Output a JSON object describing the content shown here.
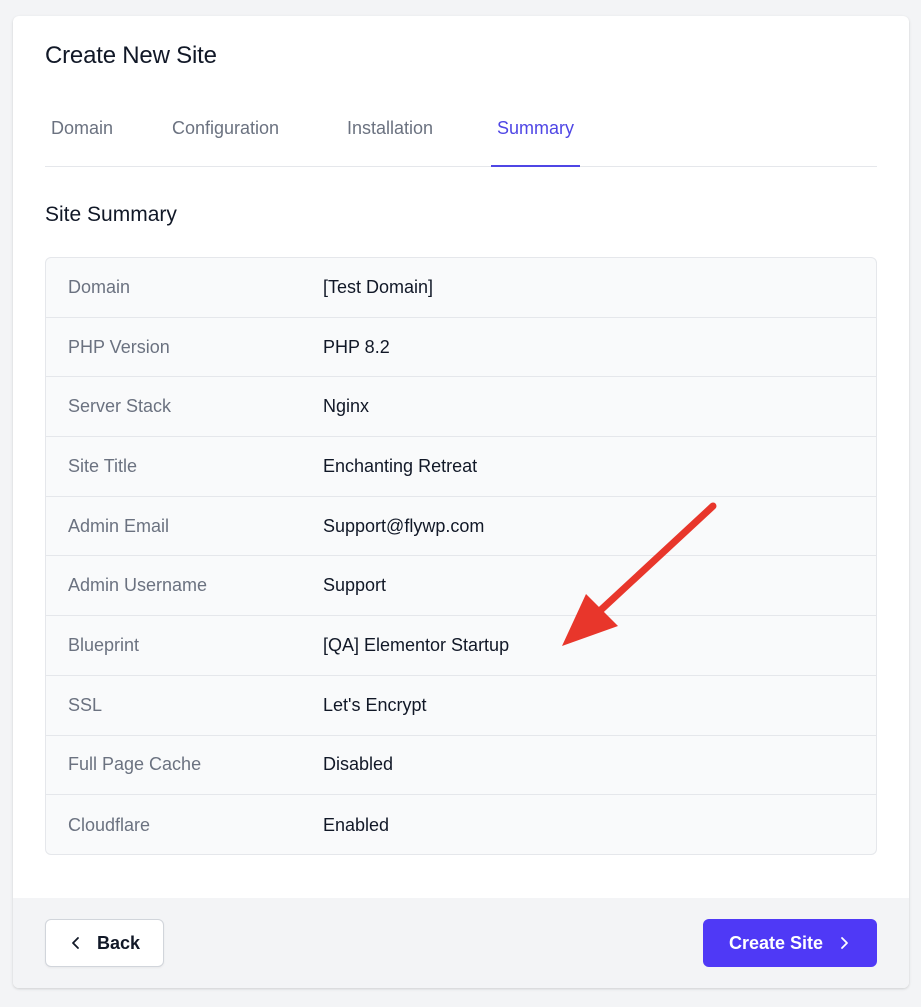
{
  "page": {
    "title": "Create New Site"
  },
  "tabs": [
    {
      "label": "Domain",
      "active": false
    },
    {
      "label": "Configuration",
      "active": false
    },
    {
      "label": "Installation",
      "active": false
    },
    {
      "label": "Summary",
      "active": true
    }
  ],
  "summary": {
    "heading": "Site Summary",
    "rows": [
      {
        "label": "Domain",
        "value": "[Test Domain]"
      },
      {
        "label": "PHP Version",
        "value": "PHP 8.2"
      },
      {
        "label": "Server Stack",
        "value": "Nginx"
      },
      {
        "label": "Site Title",
        "value": "Enchanting Retreat"
      },
      {
        "label": "Admin Email",
        "value": "Support@flywp.com"
      },
      {
        "label": "Admin Username",
        "value": "Support"
      },
      {
        "label": "Blueprint",
        "value": "[QA] Elementor Startup"
      },
      {
        "label": "SSL",
        "value": "Let's Encrypt"
      },
      {
        "label": "Full Page Cache",
        "value": "Disabled"
      },
      {
        "label": "Cloudflare",
        "value": "Enabled"
      }
    ]
  },
  "footer": {
    "back_label": "Back",
    "back_icon": "chevron-left-icon",
    "create_label": "Create Site",
    "create_icon": "chevron-right-icon"
  },
  "annotation": {
    "arrow_color": "#e8362b"
  },
  "colors": {
    "accent": "#4f46e5",
    "primary_button": "#4f39f6"
  }
}
